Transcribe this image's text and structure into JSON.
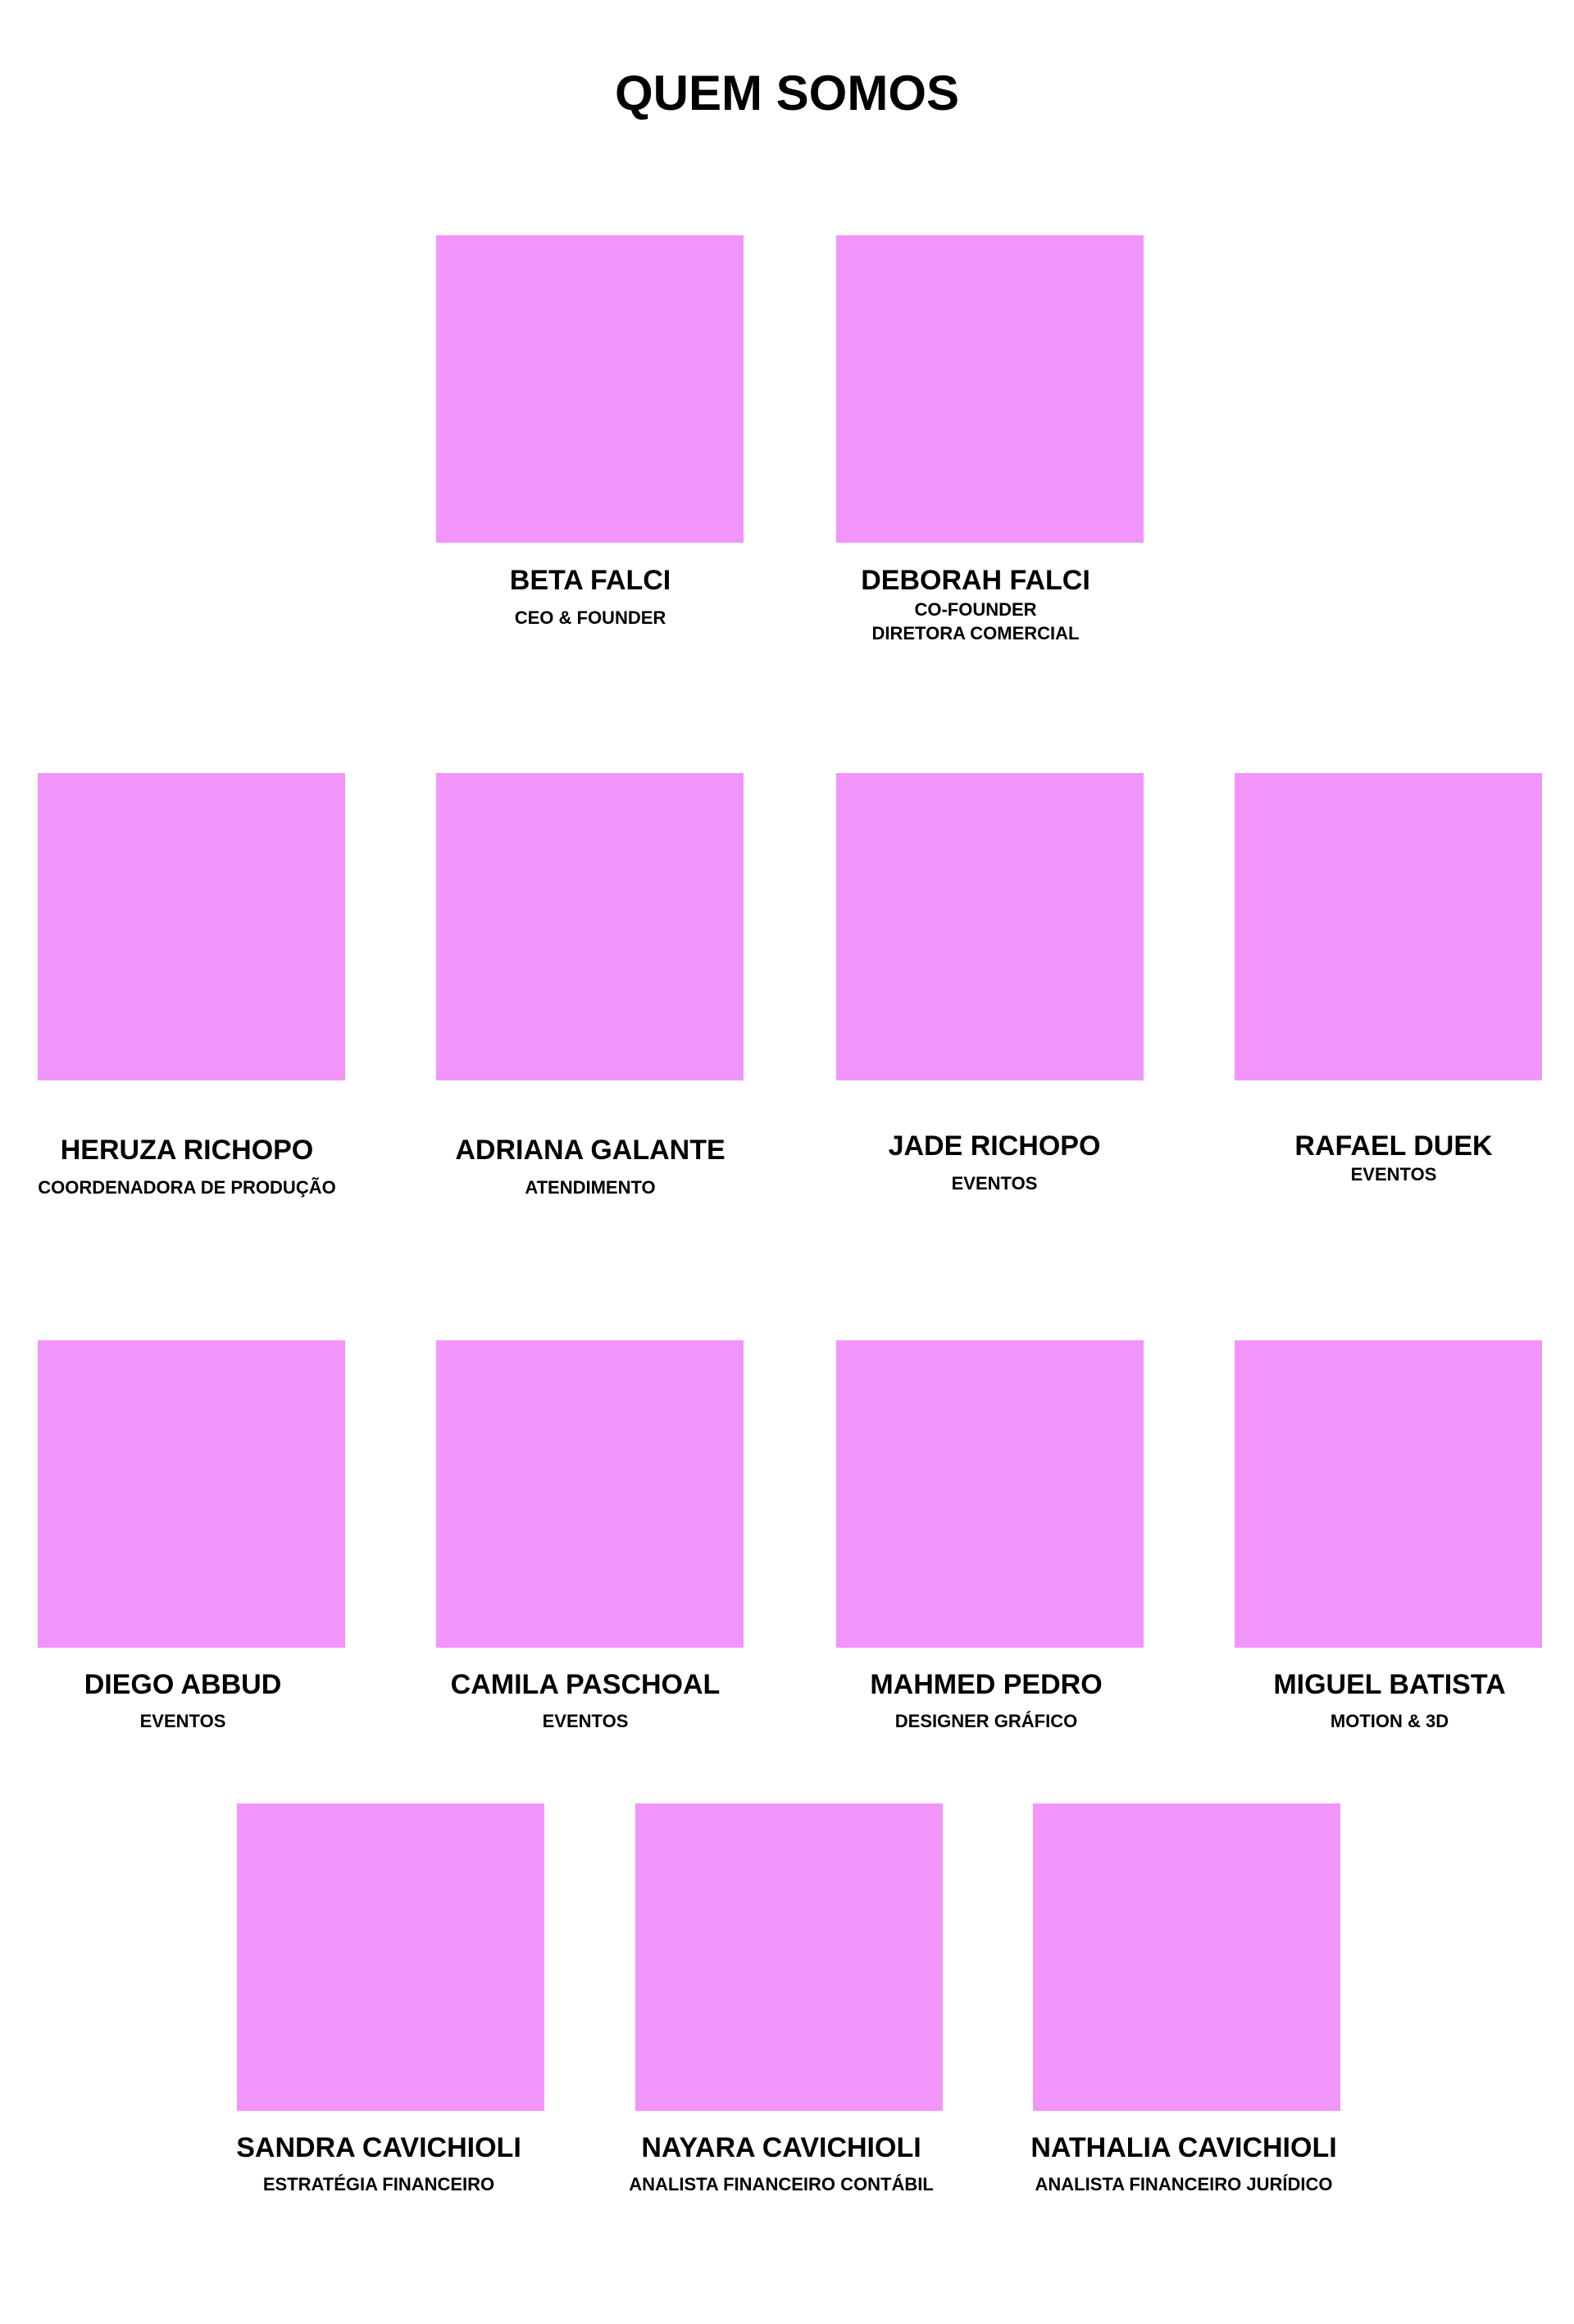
{
  "title": "QUEM SOMOS",
  "colors": {
    "photo_placeholder": "#f295fb",
    "text": "#000000",
    "background": "#ffffff"
  },
  "team": [
    {
      "name": "BETA FALCI",
      "role": [
        "CEO & FOUNDER"
      ]
    },
    {
      "name": "DEBORAH FALCI",
      "role": [
        "CO-FOUNDER",
        "DIRETORA COMERCIAL"
      ]
    },
    {
      "name": "HERUZA RICHOPO",
      "role": [
        "COORDENADORA DE PRODUÇÃO"
      ]
    },
    {
      "name": "ADRIANA GALANTE",
      "role": [
        "ATENDIMENTO"
      ]
    },
    {
      "name": "JADE RICHOPO",
      "role": [
        "EVENTOS"
      ]
    },
    {
      "name": "RAFAEL DUEK",
      "role": [
        "EVENTOS"
      ]
    },
    {
      "name": "DIEGO ABBUD",
      "role": [
        "EVENTOS"
      ]
    },
    {
      "name": "CAMILA PASCHOAL",
      "role": [
        "EVENTOS"
      ]
    },
    {
      "name": "MAHMED PEDRO",
      "role": [
        "DESIGNER GRÁFICO"
      ]
    },
    {
      "name": "MIGUEL BATISTA",
      "role": [
        "MOTION & 3D"
      ]
    },
    {
      "name": "SANDRA CAVICHIOLI",
      "role": [
        "ESTRATÉGIA FINANCEIRO"
      ]
    },
    {
      "name": "NAYARA CAVICHIOLI",
      "role": [
        "ANALISTA FINANCEIRO CONTÁBIL"
      ]
    },
    {
      "name": "NATHALIA CAVICHIOLI",
      "role": [
        "ANALISTA FINANCEIRO JURÍDICO"
      ]
    }
  ]
}
